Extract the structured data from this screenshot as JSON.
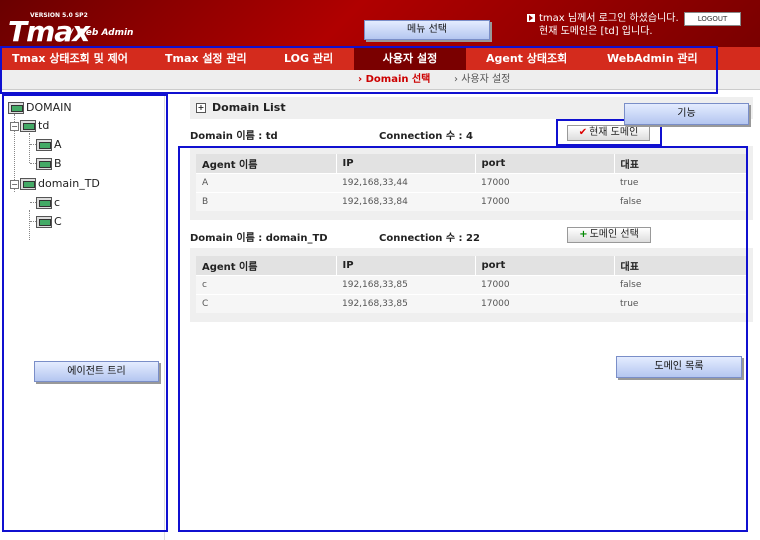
{
  "header": {
    "version": "VERSION 5.0 SP2",
    "logo": "Tmax",
    "logo_sub": "/ Web Admin",
    "user_line1": "tmax 님께서 로그인 하셨습니다.",
    "user_line2": "현재 도메인은 [td] 입니다.",
    "logout": "LOGOUT"
  },
  "nav": {
    "items": [
      {
        "label": "Tmax 상태조회 및 제어"
      },
      {
        "label": "Tmax 설정 관리"
      },
      {
        "label": "LOG 관리"
      },
      {
        "label": "사용자 설정",
        "active": true
      },
      {
        "label": "Agent 상태조회"
      },
      {
        "label": "WebAdmin 관리"
      }
    ]
  },
  "subnav": {
    "current": "Domain 선택",
    "other": "사용자 설정"
  },
  "annotations": {
    "menu": "메뉴 선택",
    "function": "기능",
    "agent_tree": "에이전트 트리",
    "domain_list": "도메인 목록"
  },
  "tree": {
    "root": "DOMAIN",
    "domains": [
      {
        "name": "td",
        "agents": [
          "A",
          "B"
        ]
      },
      {
        "name": "domain_TD",
        "agents": [
          "c",
          "C"
        ]
      }
    ]
  },
  "list": {
    "title": "Domain List",
    "domains": [
      {
        "name_label": "Domain 이름 : td",
        "conn_label": "Connection 수 : 4",
        "button": "현재 도메인",
        "columns": [
          "Agent 이름",
          "IP",
          "port",
          "대표"
        ],
        "rows": [
          [
            "A",
            "192,168,33,44",
            "17000",
            "true"
          ],
          [
            "B",
            "192,168,33,84",
            "17000",
            "false"
          ]
        ]
      },
      {
        "name_label": "Domain 이름 : domain_TD",
        "conn_label": "Connection 수 : 22",
        "button": "도메인 선택",
        "columns": [
          "Agent 이름",
          "IP",
          "port",
          "대표"
        ],
        "rows": [
          [
            "c",
            "192,168,33,85",
            "17000",
            "false"
          ],
          [
            "C",
            "192,168,33,85",
            "17000",
            "true"
          ]
        ]
      }
    ]
  }
}
